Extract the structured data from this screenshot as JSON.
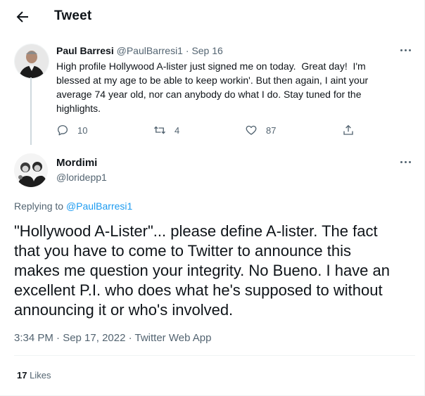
{
  "header": {
    "title": "Tweet",
    "back_icon": "arrow-left-icon"
  },
  "parent_tweet": {
    "author_name": "Paul Barresi",
    "author_handle": "@PaulBarresi1",
    "separator": "·",
    "date": "Sep 16",
    "text": "High profile Hollywood A-lister just signed me on today.  Great day!  I'm\nblessed at my age to be able to keep workin'. But then again, I aint your\naverage 74 year old, nor can anybody do what I do. Stay tuned for the\nhighlights.",
    "replies": "10",
    "retweets": "4",
    "likes": "87"
  },
  "reply_tweet": {
    "author_name": "Mordimi",
    "author_handle": "@loridepp1",
    "replying_prefix": "Replying to",
    "replying_to": "@PaulBarresi1",
    "text": "\"Hollywood A-Lister\"... please define A-lister. The fact\nthat you have to come to Twitter to announce this\nmakes me question your integrity. No Bueno. I have an\nexcellent P.I. who does what he's supposed to without\nannouncing it or who's involved.",
    "meta": "3:34 PM · Sep 17, 2022 · Twitter Web App",
    "likes_count": "17",
    "likes_label": "Likes"
  },
  "colors": {
    "accent": "#1d9bf0",
    "text_primary": "#0f1419",
    "text_secondary": "#536471",
    "thread_line": "#cfd9de"
  }
}
